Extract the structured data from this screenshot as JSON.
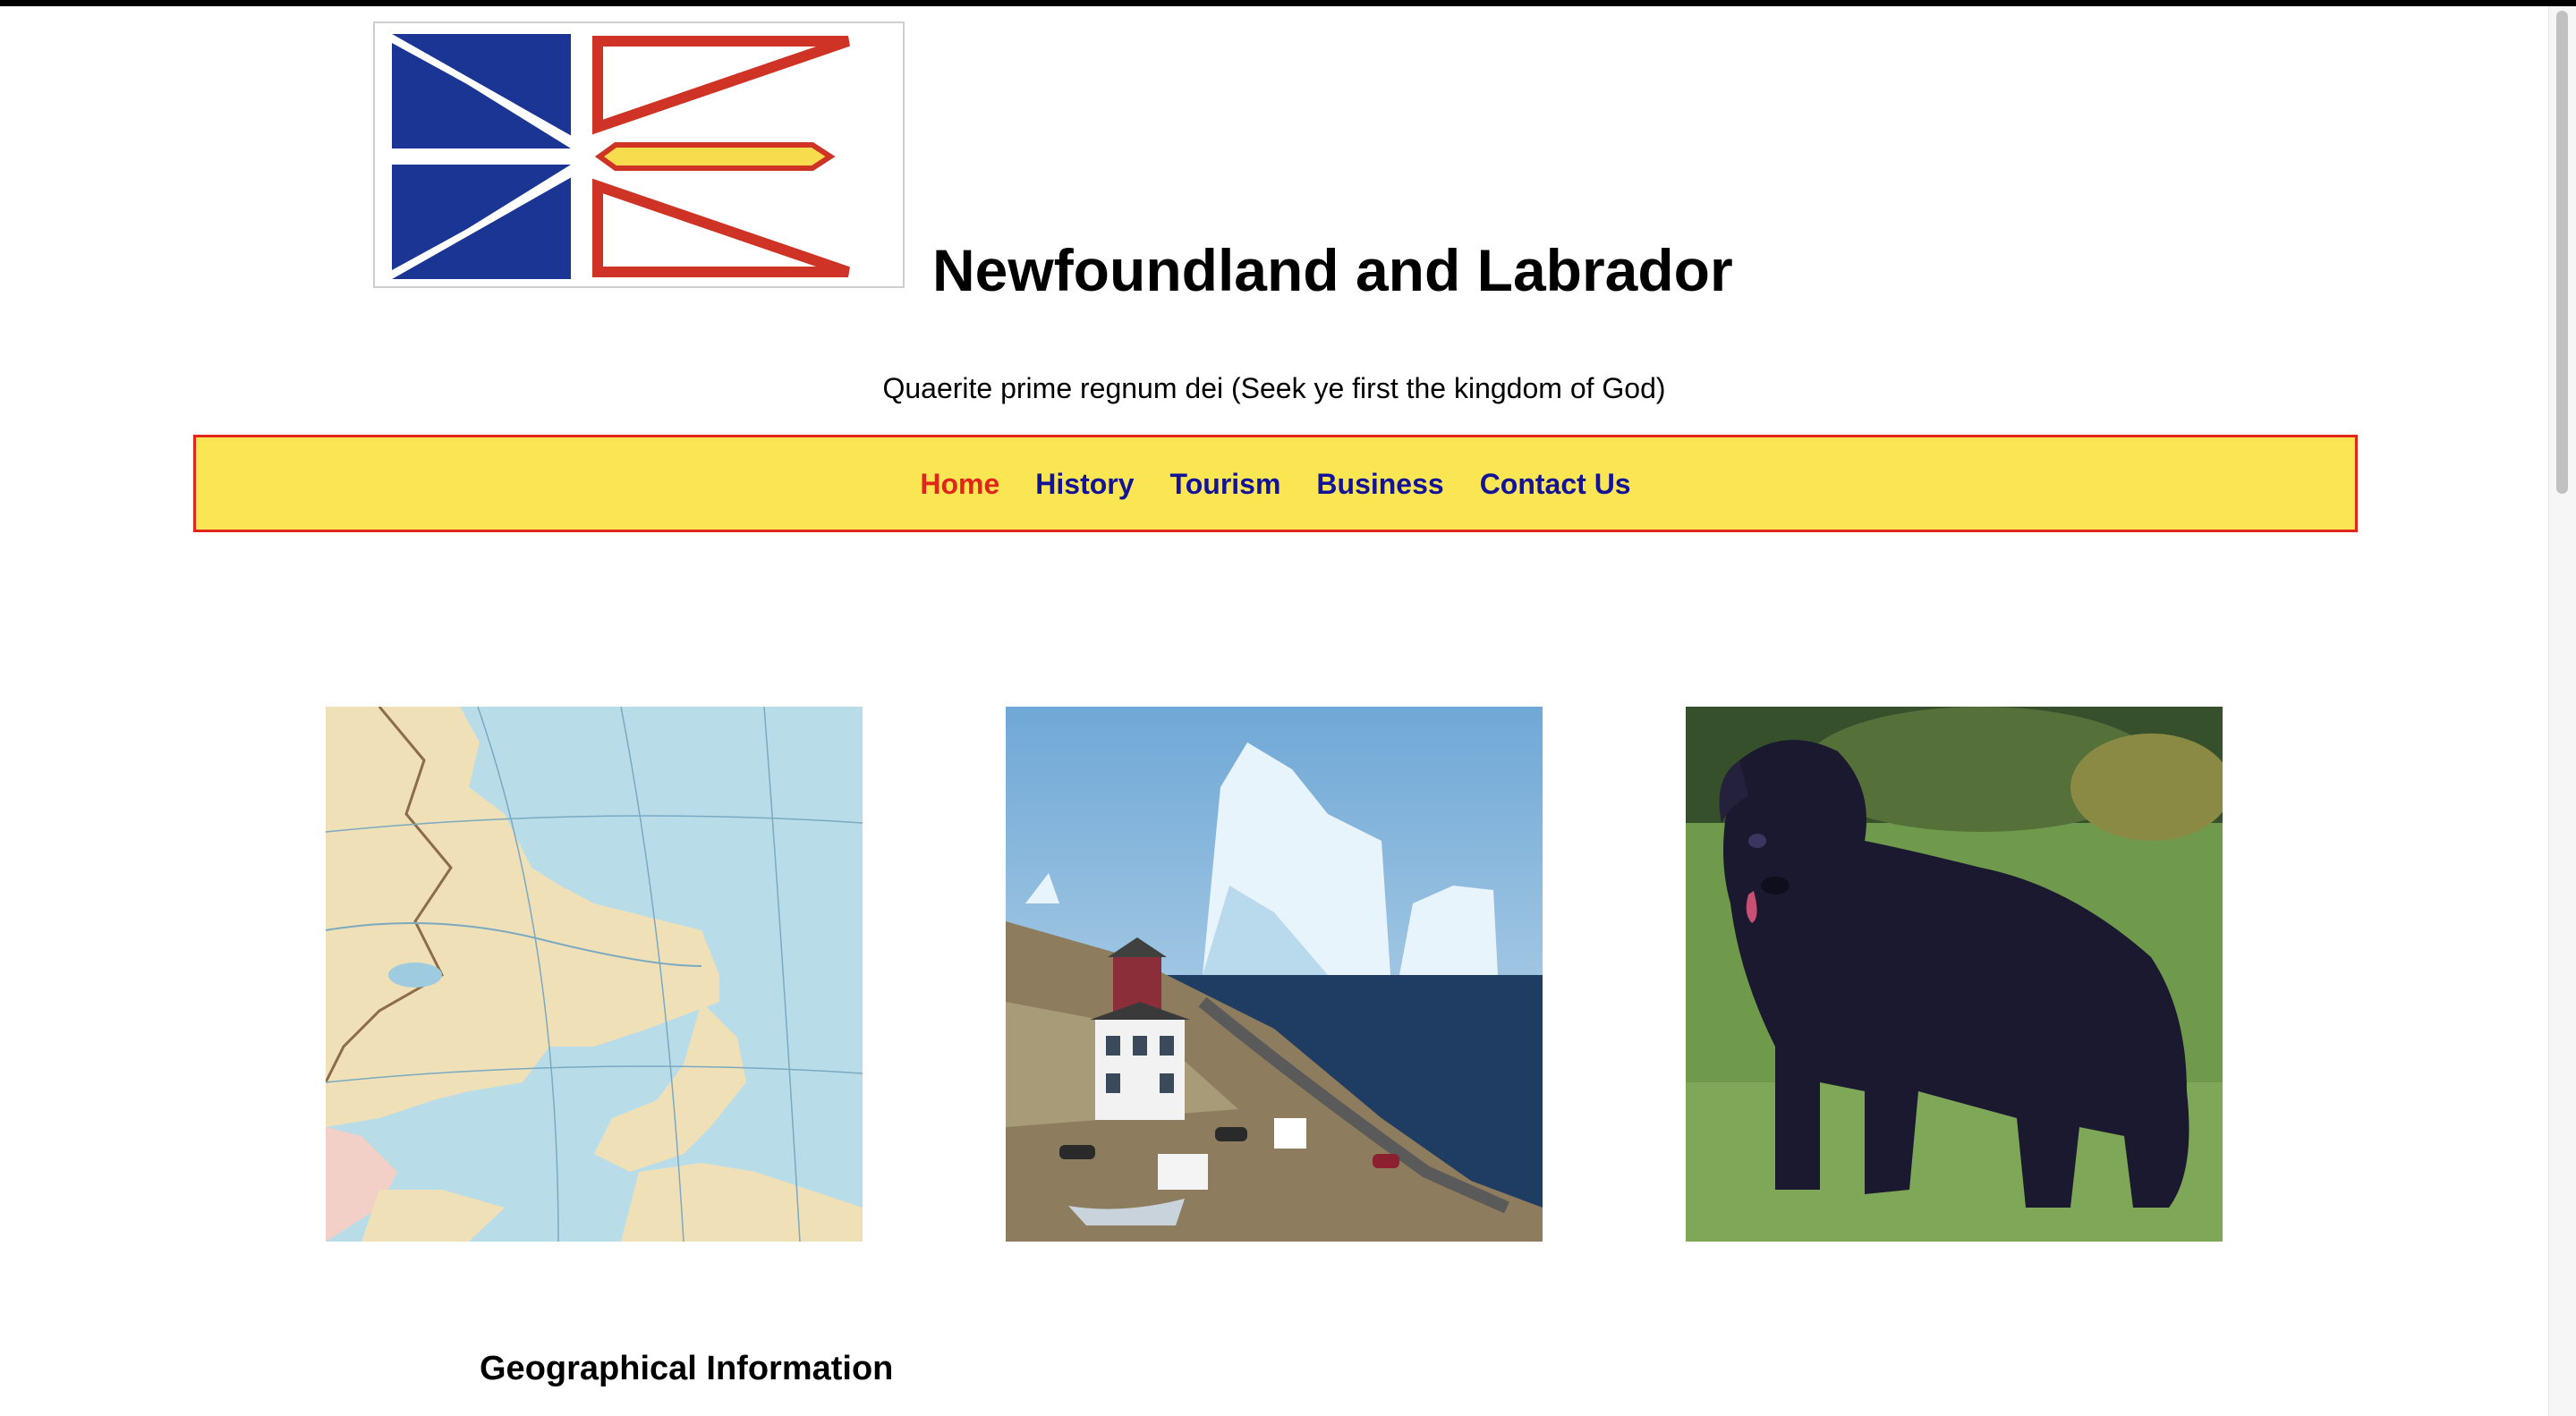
{
  "header": {
    "site_title": "Newfoundland and Labrador",
    "motto": "Quaerite prime regnum dei (Seek ye first the kingdom of God)"
  },
  "nav": {
    "items": [
      {
        "label": "Home",
        "active": true
      },
      {
        "label": "History",
        "active": false
      },
      {
        "label": "Tourism",
        "active": false
      },
      {
        "label": "Business",
        "active": false
      },
      {
        "label": "Contact Us",
        "active": false
      }
    ]
  },
  "gallery": {
    "images": [
      {
        "icon": "province-map-image"
      },
      {
        "icon": "iceberg-village-image"
      },
      {
        "icon": "newfoundland-dog-image"
      }
    ]
  },
  "sections": {
    "first_heading": "Geographical Information"
  },
  "colors": {
    "nav_background": "#fae553",
    "nav_border": "#e0251b",
    "link": "#13139a",
    "active_link": "#e0251b",
    "flag_blue": "#1a3594",
    "flag_red": "#cf3325",
    "flag_gold": "#f7dc4d"
  }
}
